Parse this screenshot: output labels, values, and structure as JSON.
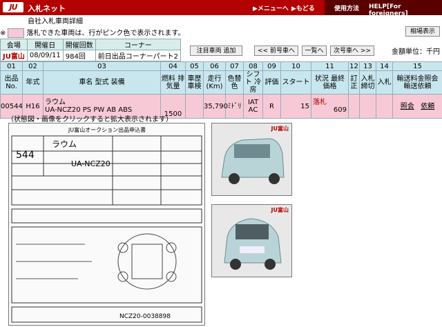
{
  "header": {
    "site_name": "入札ネット",
    "menu": "▶メニューへ",
    "back": "▶もどる",
    "usage": "使用方法",
    "help": "HELP[For foreigners]"
  },
  "sub": {
    "line1": "自社入札車両詳細",
    "line2": "入札車両詳細"
  },
  "legend": {
    "mark": "※",
    "text": "落札できた車両は、行がピンク色で表示されます。"
  },
  "buttons": {
    "quote": "相場表示",
    "add_watch": "注目車両 追加",
    "prev": "<< 前号車へ",
    "list": "一覧へ",
    "next": "次号車へ >>"
  },
  "info": {
    "h_venue": "会場",
    "h_date": "開催日",
    "h_count": "開催回数",
    "h_corner": "コーナー",
    "venue": "JU富山",
    "date": "08/09/11",
    "count": "984回",
    "corner": "前日出品コーナーパート2"
  },
  "currency": "金額単位：千円",
  "table": {
    "nums": [
      "01",
      "02",
      "03",
      "04",
      "05",
      "06",
      "07",
      "08",
      "09",
      "10",
      "11",
      "12",
      "13",
      "14",
      "15"
    ],
    "headers": [
      "出品No.",
      "年式",
      "車名 型式 装備",
      "燃料 排気量",
      "車歴 車検",
      "走行(Km)",
      "色替 色",
      "シフト 冷房",
      "評価",
      "スタート",
      "状況 最終価格",
      "訂正",
      "入札 締切",
      "入札",
      "輸送料金照会 輸送依頼"
    ],
    "row": {
      "no": "00544",
      "year": "H16",
      "name": "ラウム",
      "model": "UA-NCZ20 PS PW AB ABS",
      "cc": "1500",
      "km": "35,790",
      "color": "ﾐﾄﾞﾘ",
      "shift": "IAT",
      "ac": "AC",
      "grade": "R",
      "start": "15",
      "status": "落札",
      "final": "609",
      "link1": "照会",
      "link2": "依頼"
    }
  },
  "caption": "（状態図・画像をクリックすると拡大表示されます）",
  "sheet": {
    "title": "JU富山オークション出品申込書",
    "lot": "544",
    "car": "ラウム",
    "model": "UA-NCZ20",
    "footer": "NCZ20-0038898"
  },
  "photo_brand": "JU富山"
}
